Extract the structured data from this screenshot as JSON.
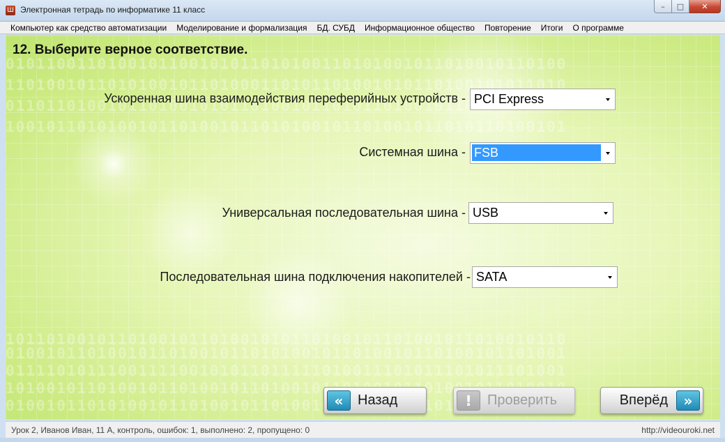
{
  "window": {
    "title": "Электронная тетрадь по информатике 11 класс",
    "icon": "app-icon",
    "minimize_icon": "–",
    "maximize_icon": "□",
    "close_icon": "✕"
  },
  "menu": {
    "items": [
      "Компьютер как средство автоматизации",
      "Моделирование и формализация",
      "БД. СУБД",
      "Информационное общество",
      "Повторение",
      "Итоги",
      "О программе"
    ]
  },
  "question": "12. Выберите верное соответствие.",
  "rows": [
    {
      "label": "Ускоренная шина взаимодействия переферийных устройств -",
      "value": "PCI Express"
    },
    {
      "label": "Системная шина -",
      "value": "FSB"
    },
    {
      "label": "Универсальная последовательная шина -",
      "value": "USB"
    },
    {
      "label": "Последовательная шина подключения накопителей -",
      "value": "SATA"
    }
  ],
  "buttons": {
    "back": {
      "label": "Назад",
      "icon": "«"
    },
    "check": {
      "label": "Проверить",
      "icon": "!"
    },
    "next": {
      "label": "Вперёд",
      "icon": "»"
    }
  },
  "status": {
    "left": "Урок 2, Иванов Иван, 11 А, контроль, ошибок: 1, выполнено: 2, пропущено: 0",
    "right": "http://videouroki.net"
  },
  "colors": {
    "background": "#dff3a6",
    "selection": "#3399ff",
    "button_accent": "#2fa5cf"
  }
}
